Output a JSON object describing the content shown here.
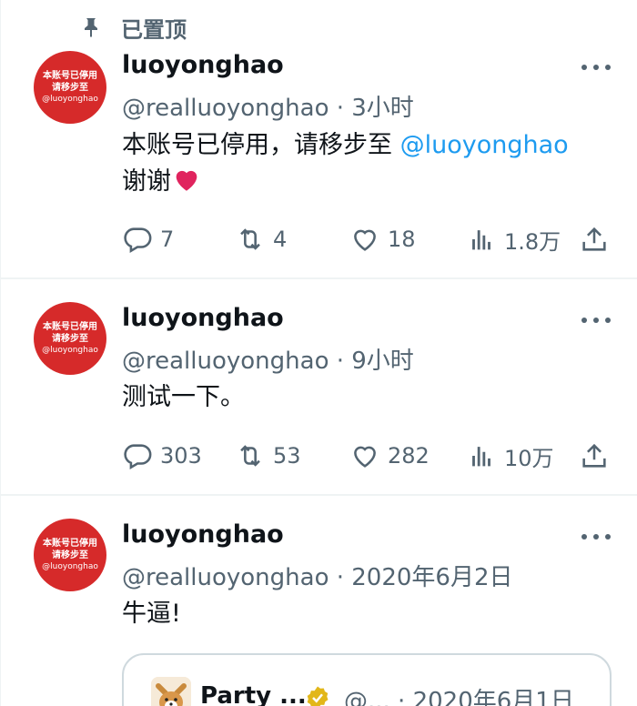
{
  "pinned_label": "已置顶",
  "colors": {
    "accent": "#1d9bf0",
    "avatar_bg": "#d62a2a",
    "muted": "#536471",
    "text": "#0f1419"
  },
  "avatar_text": {
    "line1": "本账号已停用",
    "line2": "请移步至",
    "line3": "@luoyonghao"
  },
  "tweets": [
    {
      "name": "luoyonghao",
      "handle": "@realluoyonghao · 3小时",
      "text_line1": "本账号已停用，请移步至 ",
      "mention": "@luoyonghao",
      "text_line2": "谢谢",
      "emoji": "red-heart",
      "replies": "7",
      "retweets": "4",
      "likes": "18",
      "views": "1.8万"
    },
    {
      "name": "luoyonghao",
      "handle": "@realluoyonghao · 9小时",
      "text_line1": "测试一下。",
      "replies": "303",
      "retweets": "53",
      "likes": "282",
      "views": "10万"
    },
    {
      "name": "luoyonghao",
      "handle": "@realluoyonghao · 2020年6月2日",
      "text_line1": "牛逼!",
      "quote": {
        "name": "Party ...",
        "meta": "@... · 2020年6月1日"
      }
    }
  ]
}
